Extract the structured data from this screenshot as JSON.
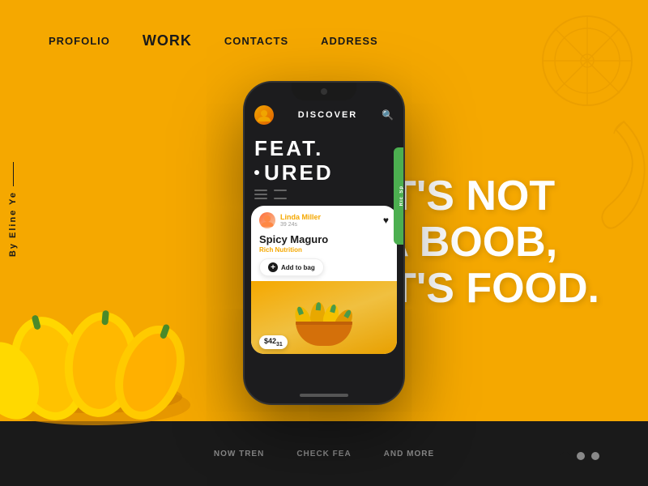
{
  "nav": {
    "items": [
      {
        "label": "PROFOLIO",
        "active": false
      },
      {
        "label": "WORK",
        "active": true
      },
      {
        "label": "CONTACTS",
        "active": false
      },
      {
        "label": "ADDRESS",
        "active": false
      }
    ]
  },
  "vertical_author": {
    "label": "By Eline Ye"
  },
  "hero": {
    "line1": "IT'S NOT",
    "line2": "A BOOB,",
    "line3": "IT'S FOOD."
  },
  "phone": {
    "app_title": "DISCOVER",
    "featured_line1": "FEAT.",
    "featured_line2": "URED",
    "card": {
      "user_name": "Linda Miller",
      "user_rating": "39 24s",
      "product_name": "Spicy Maguro",
      "product_sub": "Rich Nutrition",
      "add_button": "Add to bag",
      "price": "$42",
      "price_cents": "31"
    },
    "green_bar_text": "Sp Ric"
  },
  "bottom": {
    "links": [
      "Now Tren",
      "Check Fea",
      "And More"
    ]
  },
  "pagination": {
    "dots": [
      {
        "active": true
      },
      {
        "active": false
      },
      {
        "active": false
      }
    ]
  },
  "colors": {
    "primary": "#F5A800",
    "dark": "#1a1a1a",
    "green": "#4CAF50",
    "white": "#ffffff"
  }
}
